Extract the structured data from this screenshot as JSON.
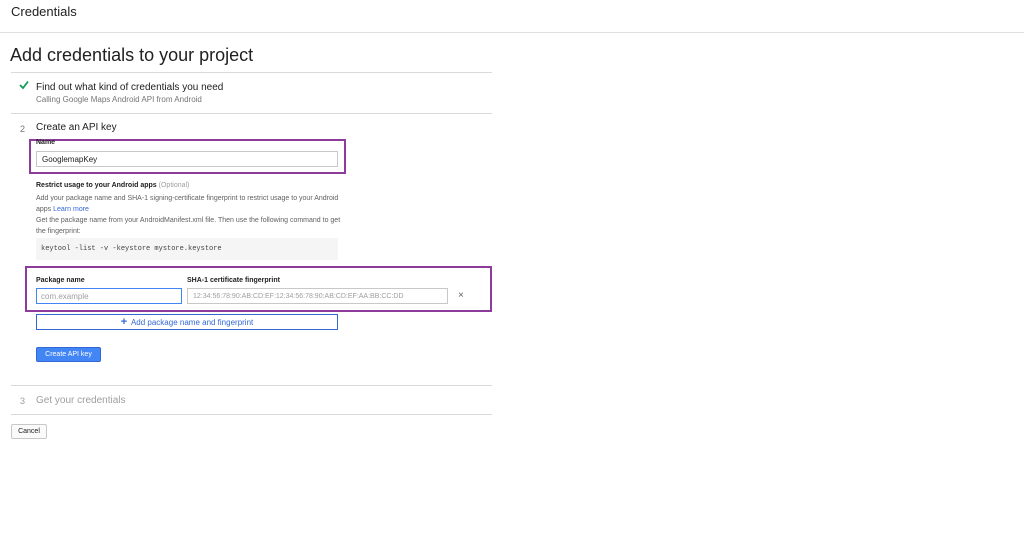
{
  "header": {
    "title": "Credentials"
  },
  "page": {
    "title": "Add credentials to your project"
  },
  "steps": {
    "step1": {
      "title": "Find out what kind of credentials you need",
      "subtitle": "Calling Google Maps Android API from Android"
    },
    "step2": {
      "number": "2",
      "title": "Create an API key",
      "name_label": "Name",
      "name_value": "GooglemapKey",
      "restrict_title": "Restrict usage to your Android apps",
      "restrict_optional": "(Optional)",
      "restrict_desc_1": "Add your package name and SHA-1 signing-certificate fingerprint to restrict usage to your Android apps",
      "learn_more": "Learn more",
      "restrict_desc_2": "Get the package name from your AndroidManifest.xml file. Then use the following command to get the fingerprint:",
      "command": "keytool -list -v -keystore mystore.keystore",
      "package_label": "Package name",
      "package_placeholder": "com.example",
      "sha_label": "SHA-1 certificate fingerprint",
      "sha_placeholder": "12:34:56:78:90:AB:CD:EF:12:34:56:78:90:AB:CD:EF:AA:BB:CC:DD",
      "remove_label": "×",
      "add_label": "Add package name and fingerprint",
      "create_label": "Create API key"
    },
    "step3": {
      "number": "3",
      "title": "Get your credentials"
    }
  },
  "footer": {
    "cancel_label": "Cancel"
  },
  "colors": {
    "accent": "#4285f4",
    "highlight": "#8e3c9b",
    "check": "#0f9d58"
  }
}
